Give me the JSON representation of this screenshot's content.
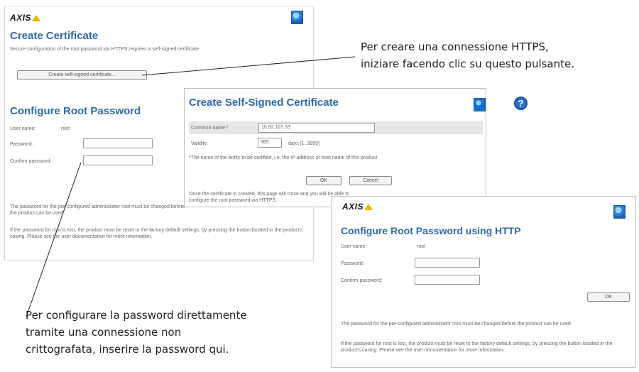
{
  "brand": {
    "logo_text": "AXIS"
  },
  "create_certificate_panel": {
    "title": "Create Certificate",
    "description": "Secure configuration of the root password via HTTPS requires a self-signed certificate.",
    "button_label": "Create self-signed certificate..."
  },
  "configure_root_panel": {
    "title": "Configure Root Password",
    "user_name_label": "User name:",
    "user_name_value": "root",
    "password_label": "Password:",
    "confirm_label": "Confirm password:",
    "note1": "The password for the pre-configured administrator root must be changed before the product can be used.",
    "note2": "If the password for root is lost, the product must be reset to the factory default settings, by pressing the button located in the product's casing. Please see the user documentation for more information."
  },
  "self_signed_dialog": {
    "title": "Create Self-Signed Certificate",
    "common_name_label": "Common name:*",
    "common_name_value": "10.92.127.33",
    "validity_label": "Validity:",
    "validity_value": "365",
    "validity_unit": "days [1..9999]",
    "footnote": "*The name of the entity to be certified, i.e. the IP address or host name of this product.",
    "ok_label": "OK",
    "cancel_label": "Cancel",
    "bottom_text_line1": "Once the certificate is created, this page will close and you will be able to",
    "bottom_text_line2": "configure the root password via HTTPS."
  },
  "http_panel": {
    "title": "Configure Root Password using HTTP",
    "user_name_label": "User name:",
    "user_name_value": "root",
    "password_label": "Password:",
    "confirm_label": "Confirm password:",
    "ok_label": "OK",
    "note1": "The password for the pre-configured administrator root must be changed before the product can be used.",
    "note2": "If the password for root is lost, the product must be reset to the factory default settings, by pressing the button located in the product's casing. Please see the user documentation for more information."
  },
  "annotations": {
    "https_line1": "Per creare una connessione HTTPS,",
    "https_line2": "iniziare facendo clic su questo pulsante.",
    "http_line1": "Per configurare la password direttamente",
    "http_line2": "tramite una connessione non",
    "http_line3": "crittografata, inserire la password qui."
  }
}
